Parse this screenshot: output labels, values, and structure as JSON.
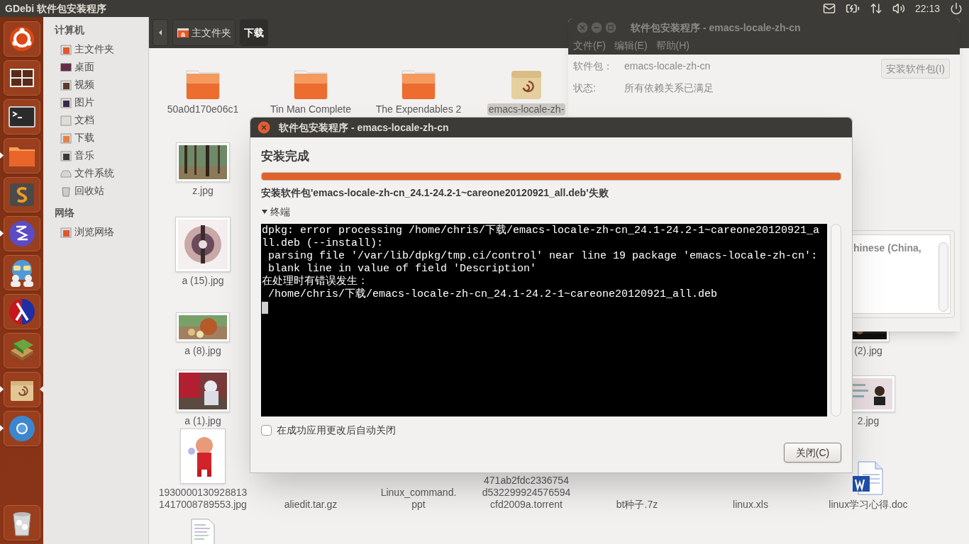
{
  "top_bar": {
    "title": "GDebi 软件包安装程序",
    "clock": "22:13"
  },
  "launcher": [
    {
      "kind": "dash",
      "running": false,
      "focused": false
    },
    {
      "kind": "workspaces",
      "running": false,
      "focused": false
    },
    {
      "kind": "terminal",
      "running": false,
      "focused": false
    },
    {
      "kind": "files",
      "running": true,
      "focused": false
    },
    {
      "kind": "editor",
      "running": false,
      "focused": false
    },
    {
      "kind": "emacs",
      "running": true,
      "focused": false
    },
    {
      "kind": "chat",
      "running": false,
      "focused": false
    },
    {
      "kind": "lambda",
      "running": false,
      "focused": false
    },
    {
      "kind": "books",
      "running": false,
      "focused": false
    },
    {
      "kind": "package",
      "running": true,
      "focused": true
    },
    {
      "kind": "browser",
      "running": true,
      "focused": false
    }
  ],
  "launcher_bottom": [
    {
      "kind": "trash",
      "running": false,
      "focused": false
    }
  ],
  "sidebar": [
    {
      "heading": "计算机",
      "items": [
        {
          "label": "主文件夹",
          "kind": "home",
          "selected": false
        },
        {
          "label": "桌面",
          "kind": "desktop",
          "selected": false
        },
        {
          "label": "视频",
          "kind": "video",
          "selected": false
        },
        {
          "label": "图片",
          "kind": "pictures",
          "selected": false
        },
        {
          "label": "文档",
          "kind": "documents",
          "selected": false
        },
        {
          "label": "下载",
          "kind": "downloads",
          "selected": false
        },
        {
          "label": "音乐",
          "kind": "music",
          "selected": false
        },
        {
          "label": "文件系统",
          "kind": "drive",
          "selected": false
        },
        {
          "label": "回收站",
          "kind": "trash",
          "selected": false
        }
      ]
    },
    {
      "heading": "网络",
      "items": [
        {
          "label": "浏览网络",
          "kind": "network",
          "selected": false
        }
      ]
    }
  ],
  "path_bar": [
    {
      "label": "主文件夹",
      "kind": "home",
      "selected": false
    },
    {
      "label": "下载",
      "kind": "plain",
      "selected": true
    }
  ],
  "file_rows": [
    [
      {
        "kind": "folder",
        "label_lines": [
          "50a0d170e06c1"
        ],
        "selected": false
      },
      {
        "kind": "folder",
        "label_lines": [
          "Tin Man Complete"
        ],
        "selected": false
      },
      {
        "kind": "folder",
        "label_lines": [
          "The Expendables 2"
        ],
        "selected": false
      },
      {
        "kind": "package",
        "label_lines": [
          "emacs-locale-zh-"
        ],
        "selected": true
      },
      null,
      null,
      null
    ],
    [
      {
        "label_lines": [
          "z.jpg"
        ],
        "selected": false
      },
      null,
      null,
      null,
      null,
      null,
      null
    ],
    [
      {
        "label_lines": [
          "a (15).jpg"
        ],
        "selected": false
      },
      null,
      null,
      null,
      null,
      null,
      null
    ],
    [
      {
        "label_lines": [
          "a (8).jpg"
        ],
        "selected": false
      },
      null,
      null,
      null,
      null,
      null,
      {
        "label_lines": [
          "(2).jpg"
        ],
        "selected": false
      }
    ],
    [
      {
        "label_lines": [
          "a (1).jpg"
        ],
        "selected": false
      },
      null,
      null,
      null,
      null,
      null,
      {
        "label_lines": [
          "2.jpg"
        ],
        "selected": false
      }
    ],
    [
      {
        "label_lines": [
          "1930000130928813",
          "1417008789553.jpg"
        ],
        "selected": false
      },
      {
        "kind": "archive",
        "label_lines": [
          "aliedit.tar.gz"
        ],
        "selected": false
      },
      {
        "kind": "slides",
        "label_lines": [
          "Linux_command.",
          "ppt"
        ],
        "selected": false
      },
      {
        "kind": "torrent",
        "label_lines": [
          "471ab2fdc2336754",
          "d532299924576594",
          "cfd2009a.torrent"
        ],
        "selected": false
      },
      {
        "kind": "archive",
        "label_lines": [
          "bt种子.7z"
        ],
        "selected": false
      },
      {
        "kind": "sheet",
        "label_lines": [
          "linux.xls"
        ],
        "selected": false
      },
      {
        "kind": "word",
        "label_lines": [
          "linux学习心得.doc"
        ],
        "selected": false
      }
    ],
    [
      {
        "kind": "text"
      },
      null,
      null,
      null,
      null,
      null,
      null
    ]
  ],
  "gdebi_window": {
    "title": "软件包安装程序 - emacs-locale-zh-cn",
    "menu": [
      "文件(F)",
      "编辑(E)",
      "帮助(H)"
    ],
    "fields": [
      {
        "label": "软件包：",
        "value": "emacs-locale-zh-cn"
      },
      {
        "label": "状态:",
        "value": "所有依赖关系已满足"
      }
    ],
    "install_button": "安装软件包(I)",
    "description_excerpt": "hinese (China,"
  },
  "dialog": {
    "title": "软件包安装程序 - emacs-locale-zh-cn",
    "heading": "安装完成",
    "progress": {
      "level": 1
    },
    "message": "安装软件包'emacs-locale-zh-cn_24.1-24.2-1~careone20120921_all.deb'失败",
    "terminal": {
      "label": "终端",
      "expanded": true,
      "lines": [
        "dpkg: error processing /home/chris/下载/emacs-locale-zh-cn_24.1-24.2-1~careone20120921_a",
        "ll.deb (--install):",
        " parsing file '/var/lib/dpkg/tmp.ci/control' near line 19 package 'emacs-locale-zh-cn':",
        " blank line in value of field 'Description'",
        "在处理时有错误发生：",
        " /home/chris/下载/emacs-locale-zh-cn_24.1-24.2-1~careone20120921_all.deb"
      ]
    },
    "auto_close": {
      "label": "在成功应用更改后自动关闭",
      "checked": false
    },
    "close_button": "关闭(C)"
  }
}
